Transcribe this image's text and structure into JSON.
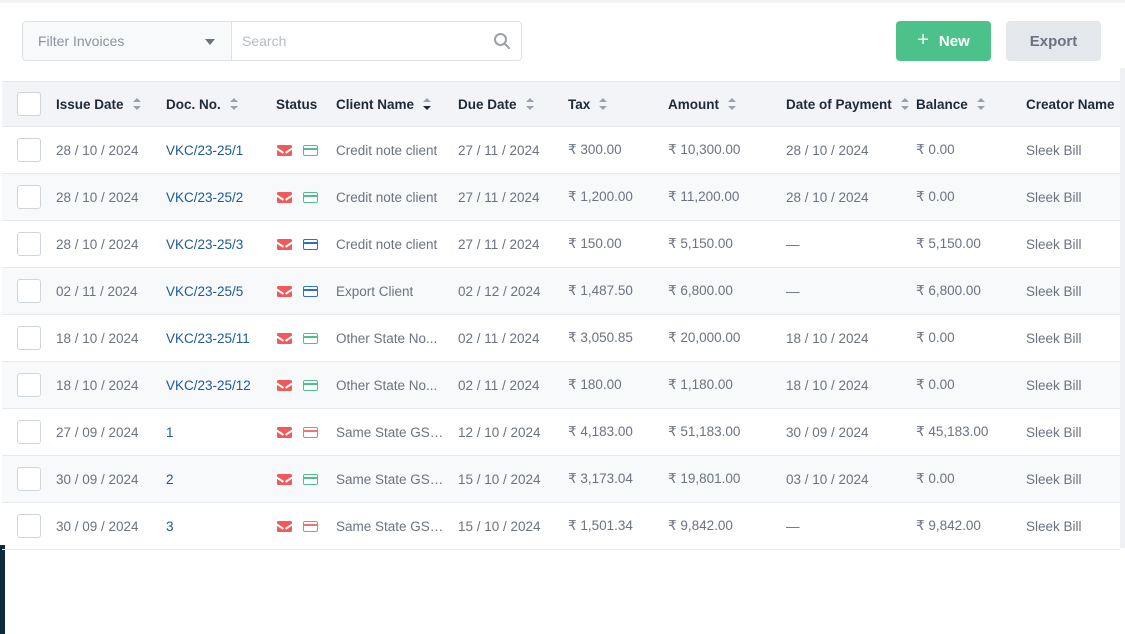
{
  "toolbar": {
    "filter_placeholder": "Filter Invoices",
    "search_placeholder": "Search",
    "new_label": "New",
    "export_label": "Export"
  },
  "table": {
    "headers": {
      "issue_date": "Issue Date",
      "doc_no": "Doc. No.",
      "status": "Status",
      "client_name": "Client Name",
      "due_date": "Due Date",
      "tax": "Tax",
      "amount": "Amount",
      "date_of_payment": "Date of Payment",
      "balance": "Balance",
      "creator_name": "Creator Name"
    },
    "rows": [
      {
        "issue_date": "28 / 10 / 2024",
        "doc_no": "VKC/23-25/1",
        "payment_status": "green",
        "client_name": "Credit note client",
        "due_date": "27 / 11 / 2024",
        "tax": "₹ 300.00",
        "amount": "₹ 10,300.00",
        "date_of_payment": "28 / 10 / 2024",
        "balance": "₹ 0.00",
        "creator_name": "Sleek Bill"
      },
      {
        "issue_date": "28 / 10 / 2024",
        "doc_no": "VKC/23-25/2",
        "payment_status": "green",
        "client_name": "Credit note client",
        "due_date": "27 / 11 / 2024",
        "tax": "₹ 1,200.00",
        "amount": "₹ 11,200.00",
        "date_of_payment": "28 / 10 / 2024",
        "balance": "₹ 0.00",
        "creator_name": "Sleek Bill"
      },
      {
        "issue_date": "28 / 10 / 2024",
        "doc_no": "VKC/23-25/3",
        "payment_status": "blue",
        "client_name": "Credit note client",
        "due_date": "27 / 11 / 2024",
        "tax": "₹ 150.00",
        "amount": "₹ 5,150.00",
        "date_of_payment": "—",
        "balance": "₹ 5,150.00",
        "creator_name": "Sleek Bill"
      },
      {
        "issue_date": "02 / 11 / 2024",
        "doc_no": "VKC/23-25/5",
        "payment_status": "blue",
        "client_name": "Export Client",
        "due_date": "02 / 12 / 2024",
        "tax": "₹ 1,487.50",
        "amount": "₹ 6,800.00",
        "date_of_payment": "—",
        "balance": "₹ 6,800.00",
        "creator_name": "Sleek Bill"
      },
      {
        "issue_date": "18 / 10 / 2024",
        "doc_no": "VKC/23-25/11",
        "payment_status": "green",
        "client_name": "Other State No...",
        "due_date": "02 / 11 / 2024",
        "tax": "₹ 3,050.85",
        "amount": "₹ 20,000.00",
        "date_of_payment": "18 / 10 / 2024",
        "balance": "₹ 0.00",
        "creator_name": "Sleek Bill"
      },
      {
        "issue_date": "18 / 10 / 2024",
        "doc_no": "VKC/23-25/12",
        "payment_status": "green",
        "client_name": "Other State No...",
        "due_date": "02 / 11 / 2024",
        "tax": "₹ 180.00",
        "amount": "₹ 1,180.00",
        "date_of_payment": "18 / 10 / 2024",
        "balance": "₹ 0.00",
        "creator_name": "Sleek Bill"
      },
      {
        "issue_date": "27 / 09 / 2024",
        "doc_no": "1",
        "payment_status": "red",
        "client_name": "Same State GST...",
        "due_date": "12 / 10 / 2024",
        "tax": "₹ 4,183.00",
        "amount": "₹ 51,183.00",
        "date_of_payment": "30 / 09 / 2024",
        "balance": "₹ 45,183.00",
        "creator_name": "Sleek Bill"
      },
      {
        "issue_date": "30 / 09 / 2024",
        "doc_no": "2",
        "payment_status": "green",
        "client_name": "Same State GST...",
        "due_date": "15 / 10 / 2024",
        "tax": "₹ 3,173.04",
        "amount": "₹ 19,801.00",
        "date_of_payment": "03 / 10 / 2024",
        "balance": "₹ 0.00",
        "creator_name": "Sleek Bill"
      },
      {
        "issue_date": "30 / 09 / 2024",
        "doc_no": "3",
        "payment_status": "red",
        "client_name": "Same State GST...",
        "due_date": "15 / 10 / 2024",
        "tax": "₹ 1,501.34",
        "amount": "₹ 9,842.00",
        "date_of_payment": "—",
        "balance": "₹ 9,842.00",
        "creator_name": "Sleek Bill"
      }
    ]
  },
  "icons": {
    "mail": "mail-icon",
    "card": "credit-card-icon",
    "search": "search-icon",
    "sort": "sort-icon"
  },
  "colors": {
    "accent_green": "#4cc28a",
    "link_blue": "#1d5a96",
    "mail_red": "#f05a5a",
    "card_blue": "#2f6fc4",
    "card_red": "#f07474"
  }
}
